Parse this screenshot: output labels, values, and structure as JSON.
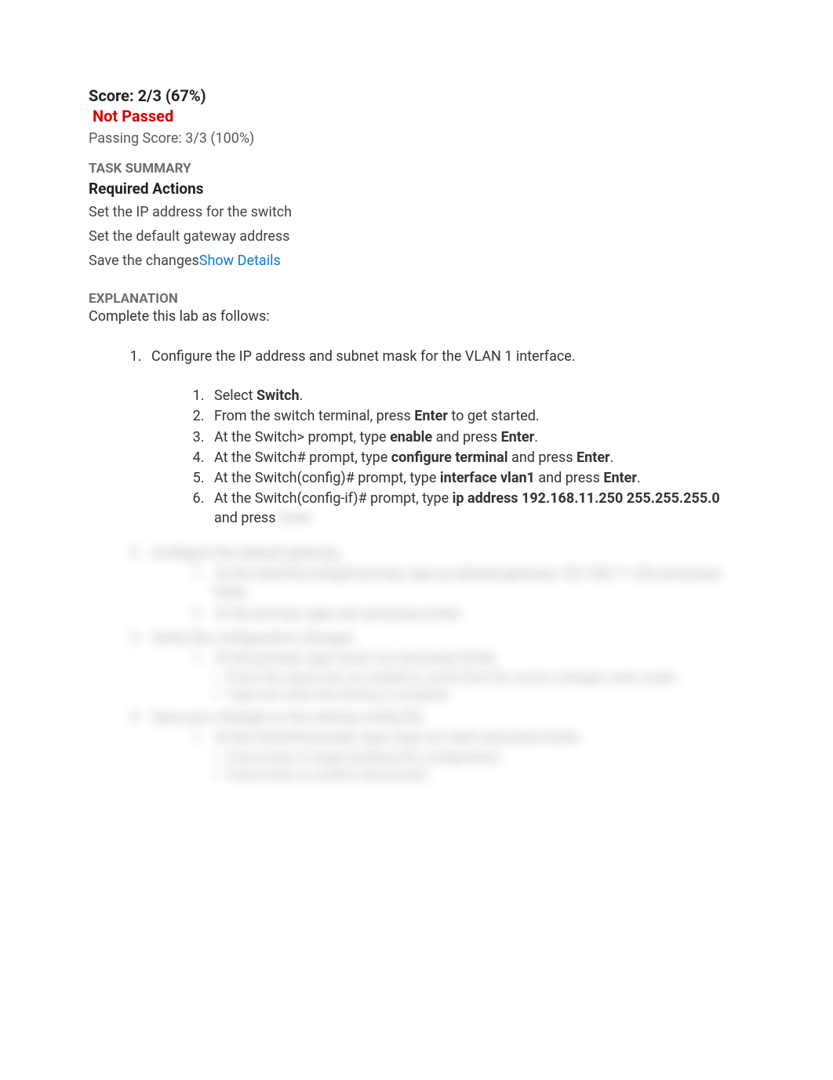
{
  "score": {
    "line": "Score: 2/3 (67%)",
    "status": "Not Passed",
    "passing": "Passing Score: 3/3 (100%)"
  },
  "task_summary": {
    "header": "TASK SUMMARY",
    "required_header": "Required Actions",
    "actions": {
      "a1": "Set the IP address for the switch",
      "a2": "Set the default gateway address",
      "a3_prefix": "Save the changes",
      "a3_link": "Show Details"
    }
  },
  "explanation": {
    "header": "EXPLANATION",
    "intro": "Complete this lab as follows:",
    "step1": {
      "title": "Configure the IP address and subnet mask for the VLAN 1 interface.",
      "s1_pre": "Select ",
      "s1_bold": "Switch",
      "s1_post": ".",
      "s2_pre": "From the switch terminal, press ",
      "s2_bold": "Enter",
      "s2_post": " to get started.",
      "s3_pre": "At the Switch> prompt, type ",
      "s3_bold1": "enable",
      "s3_mid": " and press ",
      "s3_bold2": "Enter",
      "s3_post": ".",
      "s4_pre": "At the Switch# prompt, type ",
      "s4_bold1": "configure terminal",
      "s4_mid": " and press ",
      "s4_bold2": "Enter",
      "s4_post": ".",
      "s5_pre": "At the Switch(config)# prompt, type ",
      "s5_bold1": "interface vlan1",
      "s5_mid": " and press ",
      "s5_bold2": "Enter",
      "s5_post": ".",
      "s6_pre": "At the Switch(config-if)# prompt, type ",
      "s6_bold": "ip address 192.168.11.250 255.255.255.0",
      "s6_mid": " and press ",
      "s6_blurred": "Enter."
    },
    "blurred": {
      "step2_title": "Configure the default gateway.",
      "step2_s1": "At the Switch(config)# prompt, type ip default-gateway 192.168.11.254 and press Enter.",
      "step2_s2": "At the prompt, type exit and press Enter.",
      "step3_title": "Verify the configuration changes.",
      "step3_s1": "At the prompt, type show run and press Enter.",
      "step3_b1": "Press the space bar as needed to verify that the correct changes were made.",
      "step3_b2": "Type exit when the listing is complete.",
      "step4_title": "Save your changes to the startup-config file.",
      "step4_s1": "At the Switch# prompt, type copy run start and press Enter.",
      "step4_b1": "Press Enter to begin building the configuration.",
      "step4_b2": "Press Enter to confirm the prompt."
    }
  }
}
